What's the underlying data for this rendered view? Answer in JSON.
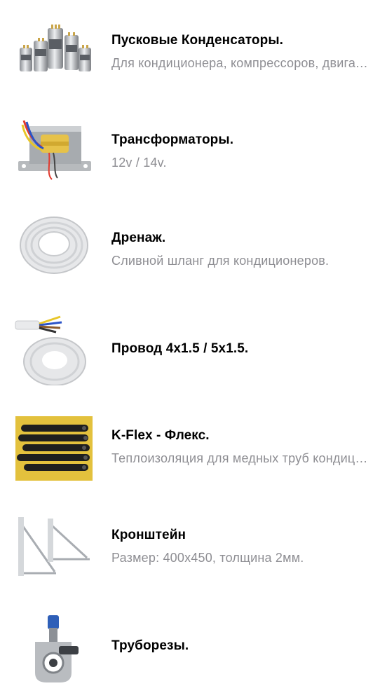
{
  "items": [
    {
      "title": "Пусковые Конденсаторы.",
      "subtitle": "Для кондиционера, компрессоров, двигателей.",
      "image": "capacitors-image"
    },
    {
      "title": "Трансформаторы.",
      "subtitle": "12v / 14v.",
      "image": "transformer-image"
    },
    {
      "title": "Дренаж.",
      "subtitle": "Сливной шланг для кондиционеров.",
      "image": "drain-hose-image"
    },
    {
      "title": "Провод 4x1.5 / 5x1.5.",
      "subtitle": "",
      "image": "cable-image"
    },
    {
      "title": "K-Flex - Флекс.",
      "subtitle": "Теплоизоляция для медных труб кондиционера.",
      "image": "k-flex-insulation-image"
    },
    {
      "title": "Кронштейн",
      "subtitle": "Размер: 400x450, толщина 2мм.",
      "image": "bracket-image"
    },
    {
      "title": "Труборезы.",
      "subtitle": "",
      "image": "pipe-cutter-image"
    }
  ],
  "colors": {
    "title": "#000000",
    "subtitle": "#8e8e93",
    "background": "#ffffff"
  }
}
